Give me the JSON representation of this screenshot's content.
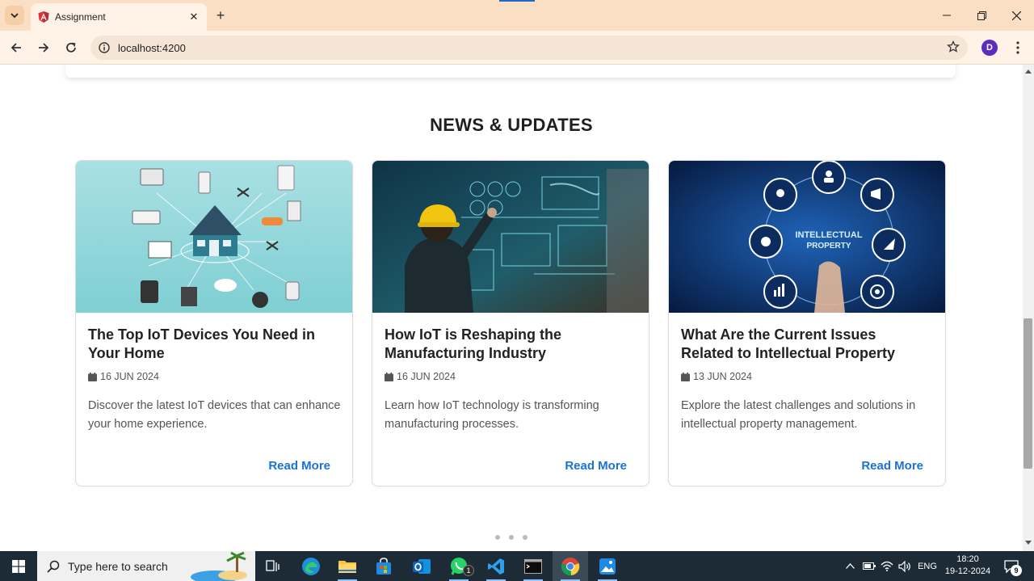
{
  "browser": {
    "tab_title": "Assignment",
    "url": "localhost:4200",
    "profile_initial": "D"
  },
  "page": {
    "section_title": "NEWS & UPDATES",
    "read_more_label": "Read More",
    "cards": [
      {
        "title": "The Top IoT Devices You Need in Your Home",
        "date": "16 JUN 2024",
        "description": "Discover the latest IoT devices that can enhance your home experience.",
        "image": "smart-home-iot-illustration"
      },
      {
        "title": "How IoT is Reshaping the Manufacturing Industry",
        "date": "16 JUN 2024",
        "description": "Learn how IoT technology is transforming manufacturing processes.",
        "image": "engineer-touchscreen-factory"
      },
      {
        "title": "What Are the Current Issues Related to Intellectual Property",
        "date": "13 JUN 2024",
        "description": "Explore the latest challenges and solutions in intellectual property management.",
        "image": "intellectual-property-icons"
      }
    ],
    "carousel_dots": 3,
    "card_image_texts": [
      "INTELLECTUAL",
      "PROPERTY"
    ]
  },
  "taskbar": {
    "search_placeholder": "Type here to search",
    "whatsapp_badge": "1",
    "language": "ENG",
    "time": "18:20",
    "date": "19-12-2024",
    "notification_count": "9"
  },
  "colors": {
    "titlebar": "#fbdfc4",
    "link": "#1a73d6",
    "taskbar": "#1d2b36"
  }
}
